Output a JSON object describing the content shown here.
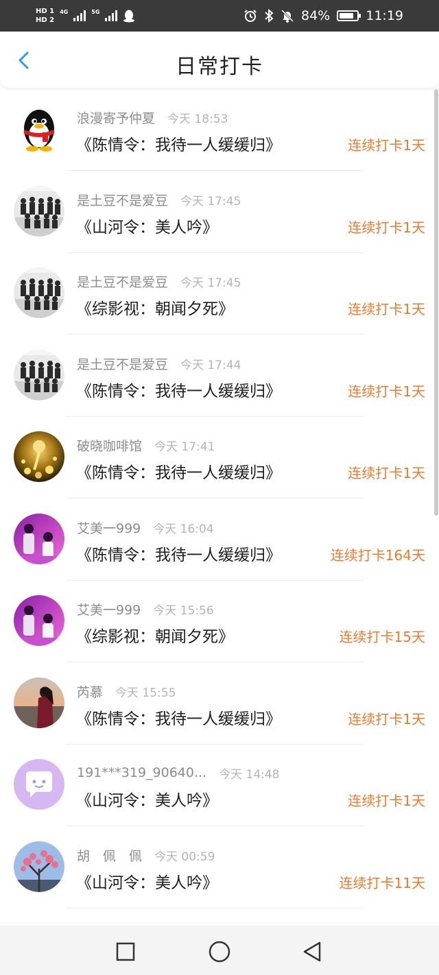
{
  "status_bar": {
    "hd1": "HD 1",
    "hd2": "HD 2",
    "net1": "4G",
    "net2": "5G",
    "battery": "84%",
    "battery_level": 0.84,
    "time": "11:19"
  },
  "header": {
    "title": "日常打卡"
  },
  "entries": [
    {
      "name": "浪漫寄予仲夏",
      "time": "今天 18:53",
      "title": "《陈情令：我待一人缓缓归》",
      "streak": "连续打卡1天",
      "avatar": "qq-penguin"
    },
    {
      "name": "是土豆不是爱豆",
      "time": "今天 17:45",
      "title": "《山河令：美人吟》",
      "streak": "连续打卡1天",
      "avatar": "group-photo"
    },
    {
      "name": "是土豆不是爱豆",
      "time": "今天 17:45",
      "title": "《综影视：朝闻夕死》",
      "streak": "连续打卡1天",
      "avatar": "group-photo"
    },
    {
      "name": "是土豆不是爱豆",
      "time": "今天 17:44",
      "title": "《陈情令：我待一人缓缓归》",
      "streak": "连续打卡1天",
      "avatar": "group-photo"
    },
    {
      "name": "破晓咖啡馆",
      "time": "今天 17:41",
      "title": "《陈情令：我待一人缓缓归》",
      "streak": "连续打卡1天",
      "avatar": "gold-coffee"
    },
    {
      "name": "艾美一999",
      "time": "今天 16:04",
      "title": "《陈情令：我待一人缓缓归》",
      "streak": "连续打卡164天",
      "avatar": "purple-stage"
    },
    {
      "name": "艾美一999",
      "time": "今天 15:56",
      "title": "《综影视：朝闻夕死》",
      "streak": "连续打卡15天",
      "avatar": "purple-stage"
    },
    {
      "name": "芮慕",
      "time": "今天 15:55",
      "title": "《陈情令：我待一人缓缓归》",
      "streak": "连续打卡1天",
      "avatar": "sunset-girl"
    },
    {
      "name": "191***319_90640...",
      "time": "今天 14:48",
      "title": "《山河令：美人吟》",
      "streak": "连续打卡1天",
      "avatar": "chat-bubble"
    },
    {
      "name": "胡　佩　佩",
      "time": "今天 00:59",
      "title": "《山河令：美人吟》",
      "streak": "连续打卡11天",
      "avatar": "pink-blossom"
    }
  ],
  "colors": {
    "accent_blue": "#2f9bf0",
    "streak_orange": "#f07a2c",
    "status_bar": "#3a3a3a"
  },
  "nav": {
    "recents": "square-icon",
    "home": "circle-icon",
    "back": "triangle-back-icon"
  }
}
